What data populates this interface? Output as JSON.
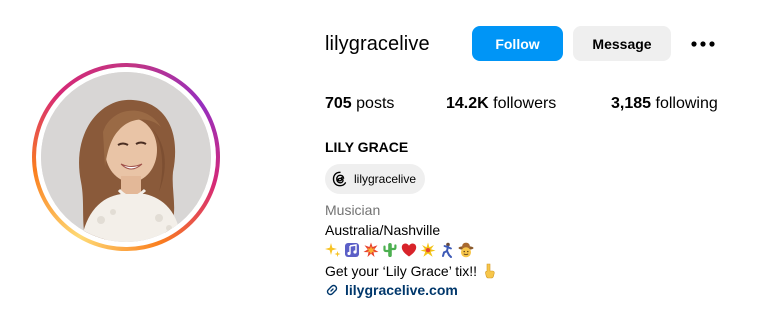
{
  "profile": {
    "username": "lilygracelive",
    "full_name": "LILY GRACE",
    "threads_handle": "lilygracelive",
    "category": "Musician",
    "location": "Australia/Nashville",
    "tagline": "Get your ‘Lily Grace’ tix!!",
    "link": "lilygracelive.com"
  },
  "actions": {
    "follow_label": "Follow",
    "message_label": "Message"
  },
  "stats": {
    "posts_count": "705",
    "posts_label": "posts",
    "followers_count": "14.2K",
    "followers_label": "followers",
    "following_count": "3,185",
    "following_label": "following"
  },
  "bio_emojis": [
    "sparkles-icon",
    "musical-notes-icon",
    "collision-icon",
    "cactus-icon",
    "heart-icon",
    "spark-burst-icon",
    "dancer-icon",
    "cowboy-face-icon"
  ],
  "colors": {
    "follow_button": "#0095f6",
    "message_button": "#efefef",
    "link": "#00376b",
    "category_text": "#737373"
  }
}
